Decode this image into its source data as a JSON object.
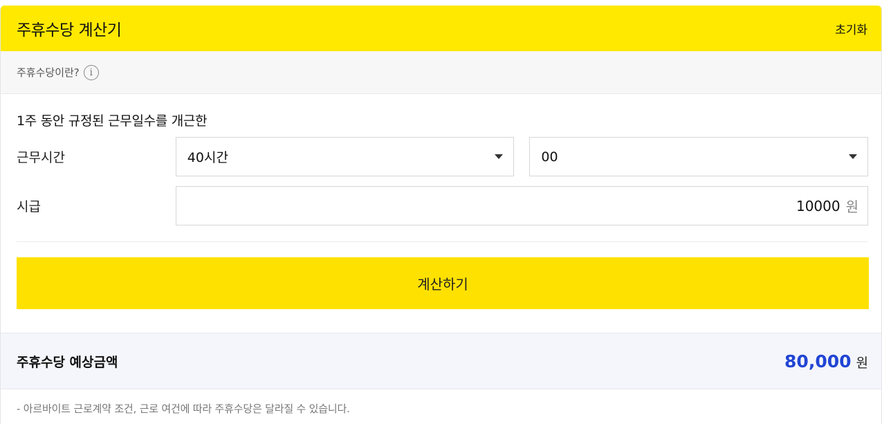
{
  "header": {
    "title": "주휴수당 계산기",
    "reset_label": "초기화",
    "accent_color": "#ffe900"
  },
  "info": {
    "label": "주휴수당이란?",
    "icon_glyph": "i",
    "icon": "info-icon"
  },
  "form": {
    "note": "1주 동안 규정된 근무일수를 개근한",
    "work_hours": {
      "label": "근무시간",
      "hours_value": "40시간",
      "minutes_value": "00"
    },
    "wage": {
      "label": "시급",
      "value": "10000",
      "unit": "원"
    },
    "calc_button_label": "계산하기",
    "button_color": "#ffe100"
  },
  "result": {
    "label": "주휴수당 예상금액",
    "amount": "80,000",
    "unit": "원",
    "amount_color": "#2145d4"
  },
  "footnote": "-  아르바이트 근로계약 조건, 근로 여건에 따라 주휴수당은 달라질 수 있습니다."
}
